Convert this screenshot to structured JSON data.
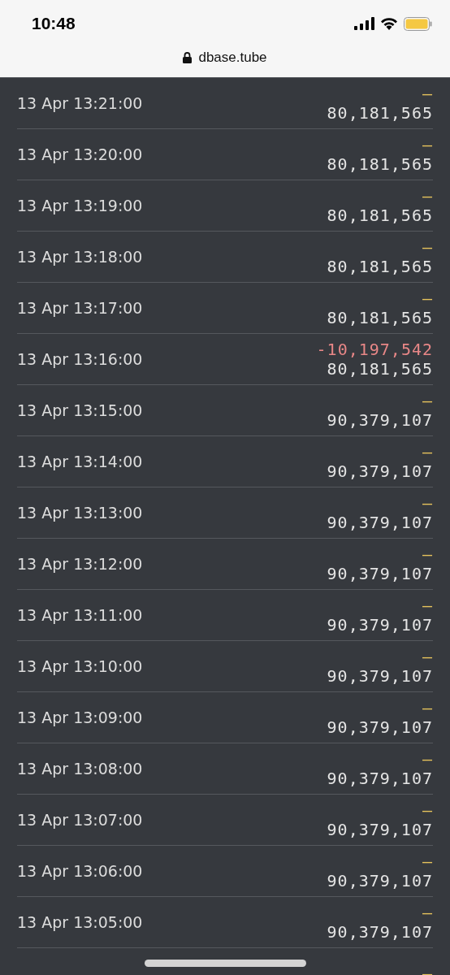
{
  "status_bar": {
    "time": "10:48"
  },
  "address_bar": {
    "url": "dbase.tube"
  },
  "rows": [
    {
      "time": "13 Apr 13:21:00",
      "change": "—",
      "decrease": false,
      "value": "80,181,565"
    },
    {
      "time": "13 Apr 13:20:00",
      "change": "—",
      "decrease": false,
      "value": "80,181,565"
    },
    {
      "time": "13 Apr 13:19:00",
      "change": "—",
      "decrease": false,
      "value": "80,181,565"
    },
    {
      "time": "13 Apr 13:18:00",
      "change": "—",
      "decrease": false,
      "value": "80,181,565"
    },
    {
      "time": "13 Apr 13:17:00",
      "change": "—",
      "decrease": false,
      "value": "80,181,565"
    },
    {
      "time": "13 Apr 13:16:00",
      "change": "-10,197,542",
      "decrease": true,
      "value": "80,181,565"
    },
    {
      "time": "13 Apr 13:15:00",
      "change": "—",
      "decrease": false,
      "value": "90,379,107"
    },
    {
      "time": "13 Apr 13:14:00",
      "change": "—",
      "decrease": false,
      "value": "90,379,107"
    },
    {
      "time": "13 Apr 13:13:00",
      "change": "—",
      "decrease": false,
      "value": "90,379,107"
    },
    {
      "time": "13 Apr 13:12:00",
      "change": "—",
      "decrease": false,
      "value": "90,379,107"
    },
    {
      "time": "13 Apr 13:11:00",
      "change": "—",
      "decrease": false,
      "value": "90,379,107"
    },
    {
      "time": "13 Apr 13:10:00",
      "change": "—",
      "decrease": false,
      "value": "90,379,107"
    },
    {
      "time": "13 Apr 13:09:00",
      "change": "—",
      "decrease": false,
      "value": "90,379,107"
    },
    {
      "time": "13 Apr 13:08:00",
      "change": "—",
      "decrease": false,
      "value": "90,379,107"
    },
    {
      "time": "13 Apr 13:07:00",
      "change": "—",
      "decrease": false,
      "value": "90,379,107"
    },
    {
      "time": "13 Apr 13:06:00",
      "change": "—",
      "decrease": false,
      "value": "90,379,107"
    },
    {
      "time": "13 Apr 13:05:00",
      "change": "—",
      "decrease": false,
      "value": "90,379,107"
    },
    {
      "change": "—",
      "decrease": false
    }
  ]
}
